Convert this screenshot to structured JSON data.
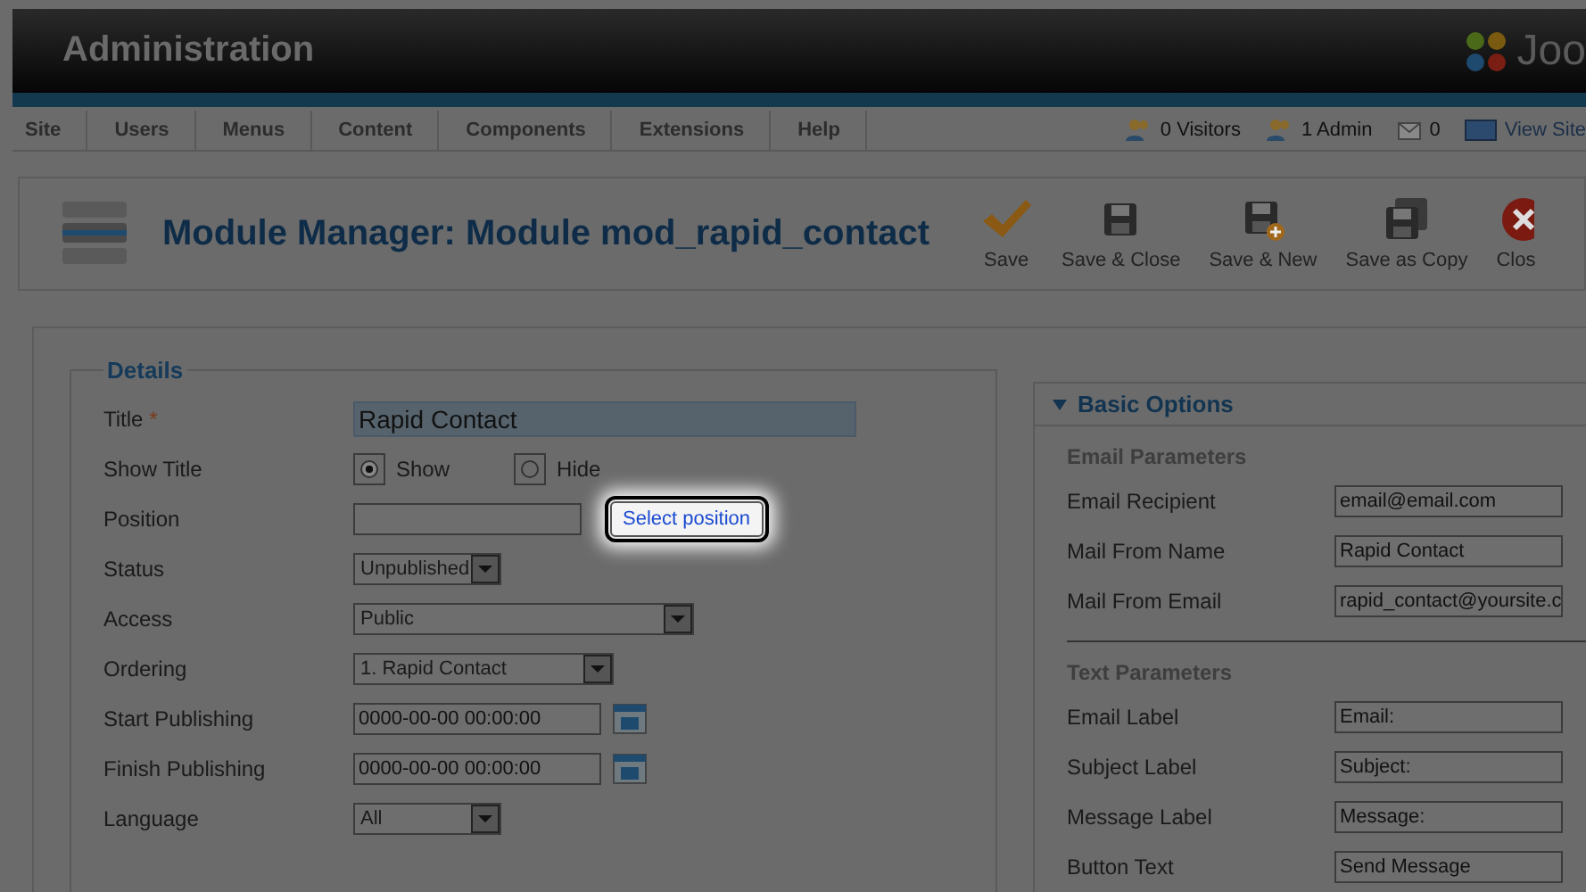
{
  "header": {
    "title": "Administration",
    "logo_text": "Joo"
  },
  "menu": {
    "items": [
      "Site",
      "Users",
      "Menus",
      "Content",
      "Components",
      "Extensions",
      "Help"
    ],
    "status": [
      {
        "kind": "visitors",
        "text": "0 Visitors"
      },
      {
        "kind": "admin",
        "text": "1 Admin"
      },
      {
        "kind": "mail",
        "text": "0"
      },
      {
        "kind": "site",
        "text": "View Site"
      }
    ]
  },
  "toolbar": {
    "title": "Module Manager: Module mod_rapid_contact",
    "buttons": [
      {
        "kind": "check",
        "label": "Save"
      },
      {
        "kind": "disk",
        "label": "Save & Close"
      },
      {
        "kind": "disk-plus",
        "label": "Save & New"
      },
      {
        "kind": "disks",
        "label": "Save as Copy"
      },
      {
        "kind": "close",
        "label": "Clos"
      }
    ]
  },
  "details": {
    "legend": "Details",
    "fields": [
      {
        "kind": "title",
        "label": "Title",
        "required_mark": "*",
        "value": "Rapid Contact"
      },
      {
        "kind": "radio",
        "label": "Show Title",
        "options": [
          {
            "label": "Show",
            "selected": true
          },
          {
            "label": "Hide",
            "selected": false
          }
        ]
      },
      {
        "kind": "position",
        "label": "Position",
        "button": "Select position",
        "highlighted": true
      },
      {
        "kind": "select",
        "label": "Status",
        "value": "Unpublished"
      },
      {
        "kind": "select",
        "label": "Access",
        "value": "Public"
      },
      {
        "kind": "select",
        "label": "Ordering",
        "value": "1. Rapid Contact"
      },
      {
        "kind": "date",
        "label": "Start Publishing",
        "value": "0000-00-00 00:00:00"
      },
      {
        "kind": "date",
        "label": "Finish Publishing",
        "value": "0000-00-00 00:00:00"
      },
      {
        "kind": "select",
        "label": "Language",
        "value": "All"
      }
    ]
  },
  "basic_options": {
    "heading": "Basic Options",
    "expanded": true,
    "groups": [
      {
        "title": "Email Parameters",
        "fields": [
          {
            "label": "Email Recipient",
            "value": "email@email.com"
          },
          {
            "label": "Mail From Name",
            "value": "Rapid Contact"
          },
          {
            "label": "Mail From Email",
            "value": "rapid_contact@yoursite.c"
          }
        ]
      },
      {
        "title": "Text Parameters",
        "fields": [
          {
            "label": "Email Label",
            "value": "Email:"
          },
          {
            "label": "Subject Label",
            "value": "Subject:"
          },
          {
            "label": "Message Label",
            "value": "Message:"
          },
          {
            "label": "Button Text",
            "value": "Send Message"
          }
        ]
      }
    ]
  }
}
